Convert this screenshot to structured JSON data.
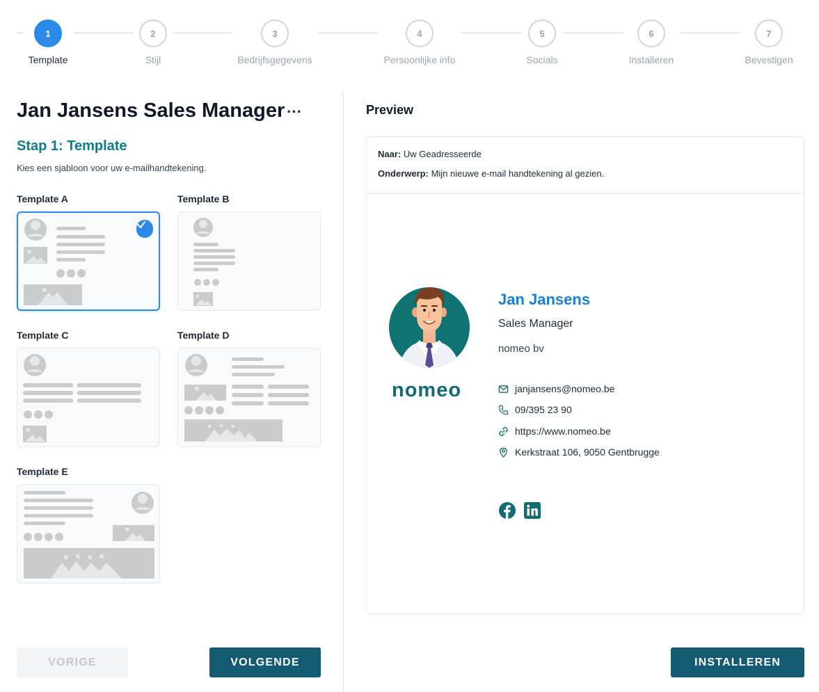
{
  "stepper": {
    "steps": [
      {
        "number": "1",
        "label": "Template",
        "active": true
      },
      {
        "number": "2",
        "label": "Stijl"
      },
      {
        "number": "3",
        "label": "Bedrijfsgegevens"
      },
      {
        "number": "4",
        "label": "Persoonlijke info"
      },
      {
        "number": "5",
        "label": "Socials"
      },
      {
        "number": "6",
        "label": "Installeren"
      },
      {
        "number": "7",
        "label": "Bevestigen"
      }
    ]
  },
  "left": {
    "title": "Jan Jansens Sales Manager",
    "more": "···",
    "step_heading": "Stap 1: Template",
    "step_desc": "Kies een sjabloon voor uw e-mailhandtekening.",
    "templates": [
      {
        "label": "Template A",
        "selected": true
      },
      {
        "label": "Template B"
      },
      {
        "label": "Template C"
      },
      {
        "label": "Template D"
      },
      {
        "label": "Template E"
      }
    ],
    "prev_label": "VORIGE",
    "next_label": "VOLGENDE"
  },
  "preview": {
    "title": "Preview",
    "to_label": "Naar:",
    "to_value": "Uw Geadresseerde",
    "subject_label": "Onderwerp:",
    "subject_value": "Mijn nieuwe e-mail handtekening al gezien.",
    "logo": "nomeo",
    "name": "Jan Jansens",
    "role": "Sales Manager",
    "company": "nomeo bv",
    "email": "janjansens@nomeo.be",
    "phone": "09/395 23 90",
    "website": "https://www.nomeo.be",
    "address": "Kerkstraat 106, 9050 Gentbrugge",
    "socials": [
      "facebook-icon",
      "linkedin-icon"
    ],
    "install_label": "INSTALLEREN"
  },
  "colors": {
    "accent": "#2b8ae5",
    "teal": "#0f7c8b",
    "button": "#135b70",
    "name": "#1b7fd1"
  }
}
